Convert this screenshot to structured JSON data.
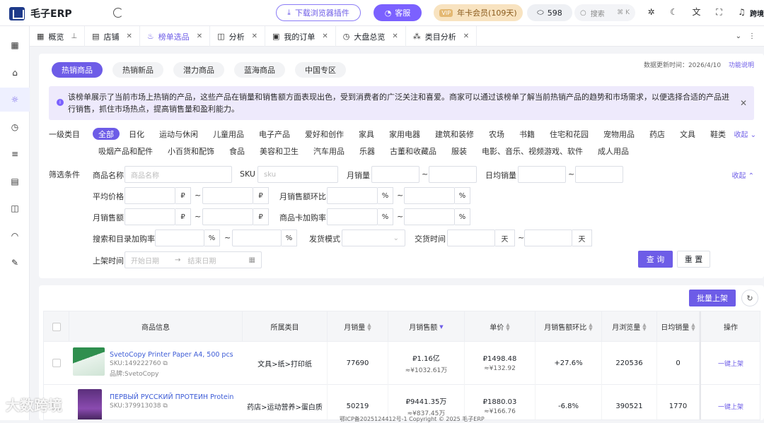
{
  "header": {
    "app_name": "毛子ERP",
    "download_label": "下载浏览器插件",
    "kefu_label": "客服",
    "vip_tag": "VIP",
    "vip_label": "年卡会员(109天)",
    "credits": "598",
    "search_placeholder": "搜索",
    "search_shortcut": "⌘ K",
    "user_name": "跨境"
  },
  "tabs": [
    {
      "label": "概览",
      "icon": "grid-icon",
      "closable": false
    },
    {
      "label": "店铺",
      "icon": "shop-icon",
      "closable": true
    },
    {
      "label": "榜单选品",
      "icon": "fire-icon",
      "closable": true,
      "active": true
    },
    {
      "label": "分析",
      "icon": "chart-icon",
      "closable": true
    },
    {
      "label": "我的订单",
      "icon": "doc-icon",
      "closable": true
    },
    {
      "label": "大盘总览",
      "icon": "clock-icon",
      "closable": true
    },
    {
      "label": "类目分析",
      "icon": "category-icon",
      "closable": true
    }
  ],
  "subtabs": [
    "热销商品",
    "热销新品",
    "潜力商品",
    "蓝海商品",
    "中国专区"
  ],
  "update": {
    "text": "数据更新时间：2026/4/10",
    "link": "功能说明"
  },
  "notice": "该榜单展示了当前市场上热销的产品，这些产品在销量和销售额方面表现出色，受到消费者的广泛关注和喜爱。商家可以通过该榜单了解当前热销产品的趋势和市场需求，以便选择合适的产品进行销售，抓住市场热点，提高销售量和盈利能力。",
  "categories": {
    "label": "一级类目",
    "fold": "收起",
    "items": [
      "全部",
      "日化",
      "运动与休闲",
      "儿童用品",
      "电子产品",
      "爱好和创作",
      "家具",
      "家用电器",
      "建筑和装修",
      "农场",
      "书籍",
      "住宅和花园",
      "宠物用品",
      "药店",
      "文具",
      "鞋类",
      "吸烟产品和配件",
      "小百货和配饰",
      "食品",
      "美容和卫生",
      "汽车用品",
      "乐器",
      "古董和收藏品",
      "服装",
      "电影、音乐、视频游戏、软件",
      "成人用品"
    ]
  },
  "filters": {
    "label": "筛选条件",
    "fold": "收起",
    "name_label": "商品名称",
    "name_placeholder": "商品名称",
    "sku_label": "SKU",
    "sku_placeholder": "sku",
    "monthly_sales": "月销量",
    "daily_sales": "日均销量",
    "avg_price": "平均价格",
    "ratio": "月销售额环比",
    "monthly_revenue": "月销售额",
    "card_cart": "商品卡加购率",
    "search_cart": "搜索和目录加购率",
    "ship_mode": "发货模式",
    "delivery_time": "交货时间",
    "listing_time": "上架时间",
    "start_date": "开始日期",
    "end_date": "结束日期",
    "ruble": "₽",
    "percent": "%",
    "day": "天",
    "tilde": "~",
    "arrow": "→",
    "query": "查 询",
    "reset": "重 置"
  },
  "table": {
    "batch": "批量上架",
    "columns": [
      "商品信息",
      "所属类目",
      "月销量",
      "月销售额",
      "单价",
      "月销售额环比",
      "月浏览量",
      "日均销量",
      "操作"
    ],
    "rows": [
      {
        "title": "SvetoCopy Printer Paper A4, 500 pcs",
        "sku": "SKU:149222760",
        "brand": "品牌:SvetoCopy",
        "category": "文具>纸>打印纸",
        "sales": "77690",
        "revenue": "₽1.16亿",
        "revenue_cny": "≈¥1032.61万",
        "price": "₽1498.48",
        "price_cny": "≈¥132.92",
        "ratio": "+27.6%",
        "views": "220536",
        "daily": "0",
        "op": "一键上架",
        "thumb_color": "#3a9b5a"
      },
      {
        "title": "ПЕРВЫЙ РУССКИЙ ПРОТЕИН Protein",
        "sku": "SKU:379913038",
        "brand": "",
        "category": "药店>运动营养>蛋白质",
        "sales": "50219",
        "revenue": "₽9441.35万",
        "revenue_cny": "≈¥837.45万",
        "price": "₽1880.03",
        "price_cny": "≈¥166.76",
        "ratio": "-6.8%",
        "views": "390521",
        "daily": "1770",
        "op": "一键上架",
        "thumb_color": "#7c4a9c"
      }
    ]
  },
  "footer": "鄂ICP备2025124412号-1 Copyright © 2025 毛子ERP",
  "watermark": "大数跨境"
}
